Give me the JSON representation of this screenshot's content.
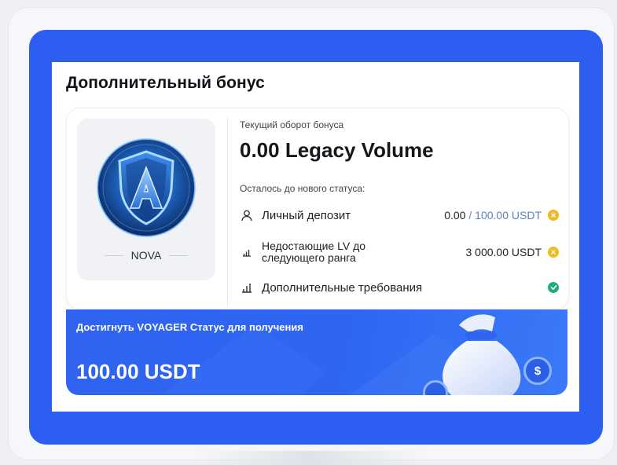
{
  "bonus": {
    "title": "Дополнительный бонус",
    "level_name": "NOVA",
    "current_turnover_label": "Текущий оборот бонуса",
    "current_turnover_value": "0.00 Legacy Volume",
    "remaining_label": "Осталось до нового статуса:",
    "requirements": [
      {
        "icon": "user-icon",
        "label": "Личный депозит",
        "value_current": "0.00",
        "value_separator": " / ",
        "value_target": "100.00 USDT",
        "status": "pending"
      },
      {
        "icon": "bar-chart-icon",
        "label_line1": "Недостающие LV до",
        "label_line2": "следующего ранга",
        "value": "3 000.00 USDT",
        "status": "pending"
      },
      {
        "icon": "bar-chart-icon",
        "label": "Дополнительные требования",
        "status": "done"
      }
    ],
    "banner_text": "Достигнуть VOYAGER Статус для получения",
    "reward": "100.00 USDT",
    "coin_symbol": "$"
  },
  "colors": {
    "accent_blue": "#2d5ef2",
    "pending": "#f1b821",
    "done": "#22b07a"
  }
}
